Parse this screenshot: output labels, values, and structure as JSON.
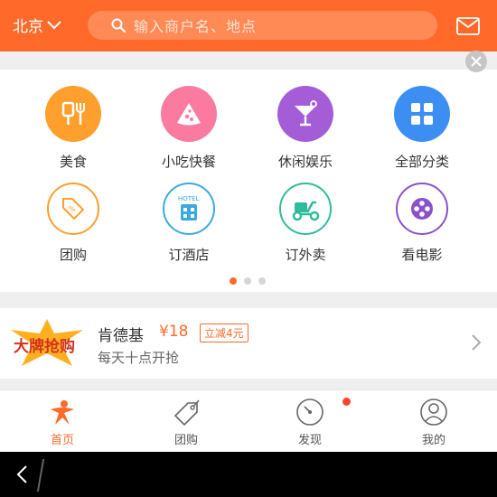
{
  "header": {
    "city": "北京",
    "search_placeholder": "输入商户名、地点"
  },
  "categories": [
    {
      "label": "美食",
      "icon": "fork-knife-icon",
      "color": "#ff9f2d"
    },
    {
      "label": "小吃快餐",
      "icon": "pizza-slice-icon",
      "color": "#fa7aa0"
    },
    {
      "label": "休闲娱乐",
      "icon": "cocktail-icon",
      "color": "#a45dd6"
    },
    {
      "label": "全部分类",
      "icon": "grid-icon",
      "color": "#3d8ef2"
    },
    {
      "label": "团购",
      "icon": "coupon-tag-icon",
      "color": "#ff9f2d"
    },
    {
      "label": "订酒店",
      "icon": "hotel-icon",
      "color": "#3aa9df",
      "icon_text": "HOTEL"
    },
    {
      "label": "订外卖",
      "icon": "scooter-icon",
      "color": "#2fbc9a"
    },
    {
      "label": "看电影",
      "icon": "film-reel-icon",
      "color": "#8a52c8"
    }
  ],
  "pager": {
    "pages": 3,
    "active": 1
  },
  "promo": {
    "logo_text": "大牌抢购",
    "title": "肯德基",
    "price": "¥18",
    "badge": "立减4元",
    "subtitle": "每天十点开抢"
  },
  "tabs": [
    {
      "label": "首页",
      "icon": "home-person-icon",
      "active": true
    },
    {
      "label": "团购",
      "icon": "tag-icon",
      "active": false
    },
    {
      "label": "发现",
      "icon": "compass-icon",
      "active": false,
      "has_dot": true
    },
    {
      "label": "我的",
      "icon": "user-icon",
      "active": false
    }
  ],
  "colors": {
    "accent": "#ff6a2a",
    "badge_dot": "#ff4430"
  }
}
